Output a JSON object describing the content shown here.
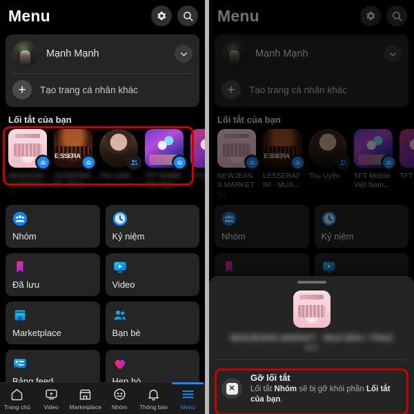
{
  "header": {
    "title": "Menu",
    "settings_icon": "gear-icon",
    "search_icon": "search-icon"
  },
  "profile": {
    "name": "Mạnh Mạnh",
    "expand_icon": "chevron-down-icon",
    "create_profile_label": "Tạo trang cá nhân khác",
    "plus_icon": "plus-icon"
  },
  "shortcuts": {
    "section_title": "Lối tắt của bạn",
    "items": [
      {
        "label": "NEWJEANS MARKET -...",
        "badge": "group-badge",
        "shape": "rounded",
        "art": "art-nj"
      },
      {
        "label": "LESSERAFIM - MUA...",
        "badge": "group-badge",
        "shape": "rounded",
        "art": "art-ls"
      },
      {
        "label": "Thu Uyên",
        "badge": "friends-badge",
        "shape": "circle",
        "art": "art-girl"
      },
      {
        "label": "TFT Mobile Việt Nam...",
        "badge": "group-badge",
        "shape": "rounded",
        "art": "art-tft"
      },
      {
        "label": "TFT ĐTC...",
        "badge": "group-badge",
        "shape": "rounded",
        "art": "art-tft2"
      }
    ]
  },
  "menu_grid": [
    {
      "label": "Nhóm",
      "icon": "groups-icon"
    },
    {
      "label": "Kỷ niệm",
      "icon": "memories-clock-icon"
    },
    {
      "label": "Đã lưu",
      "icon": "saved-bookmark-icon"
    },
    {
      "label": "Video",
      "icon": "video-icon"
    },
    {
      "label": "Marketplace",
      "icon": "marketplace-store-icon"
    },
    {
      "label": "Bạn bè",
      "icon": "friends-icon"
    },
    {
      "label": "Bảng feed",
      "icon": "feeds-icon"
    },
    {
      "label": "Hẹn hò",
      "icon": "dating-heart-icon"
    }
  ],
  "bottom_nav": [
    {
      "label": "Trang chủ",
      "icon": "home-icon",
      "active": false
    },
    {
      "label": "Video",
      "icon": "video-icon",
      "active": false
    },
    {
      "label": "Marketplace",
      "icon": "marketplace-icon",
      "active": false
    },
    {
      "label": "Nhóm",
      "icon": "groups-icon",
      "active": false
    },
    {
      "label": "Thông báo",
      "icon": "bell-icon",
      "active": false
    },
    {
      "label": "Menu",
      "icon": "hamburger-icon",
      "active": true
    }
  ],
  "sheet": {
    "grabber": "drag-handle",
    "thumb_art": "art-nj",
    "title_blurred": "NEWJEANS MARKET - MUA BÁN / TRAO",
    "sub_blurred": "ĐỔI",
    "option": {
      "icon": "remove-x-icon",
      "title": "Gỡ lối tắt",
      "desc_parts": [
        "Lối tắt ",
        "Nhóm",
        " sẽ bị gỡ khỏi phần ",
        "Lối tắt của bạn",
        "."
      ]
    }
  },
  "colors": {
    "accent": "#1b8bf9",
    "highlight_border": "#cc0000",
    "panel_bg": "#000000",
    "card_bg": "#252525"
  }
}
